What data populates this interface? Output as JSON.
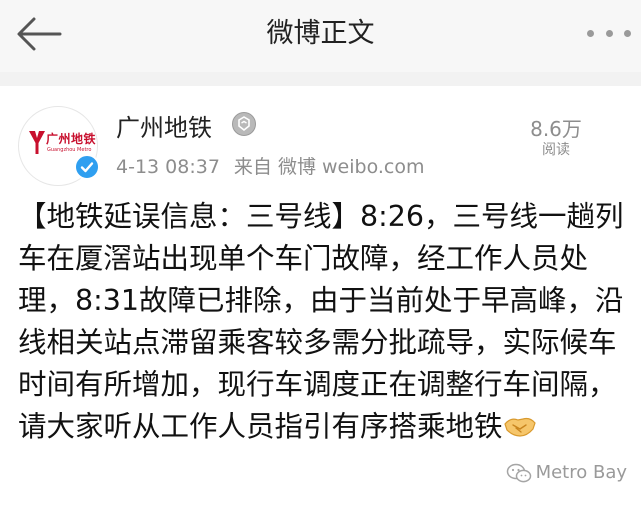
{
  "header": {
    "title": "微博正文",
    "back_icon": "back-arrow-icon",
    "more_icon": "more-dots-icon"
  },
  "post": {
    "avatar": {
      "logo_text_cn": "广州地铁",
      "logo_text_en": "Guangzhou Metro",
      "brand_color": "#c8102e"
    },
    "username": "广州地铁",
    "verified_color": "#2f9ff0",
    "timestamp": "4-13 08:37",
    "source": "来自 微博 weibo.com",
    "read_count": "8.6万",
    "read_label": "阅读",
    "content": "【地铁延误信息：三号线】8:26，三号线一趟列车在厦滘站出现单个车门故障，经工作人员处理，8:31故障已排除，由于当前处于早高峰，沿线相关站点滞留乘客较多需分批疏导，实际候车时间有所增加，现行车调度正在调整行车间隔，请大家听从工作人员指引有序搭乘地铁",
    "content_emoji": "handshake-emoji"
  },
  "watermark": {
    "text": "Metro Bay",
    "icon": "wechat-icon"
  }
}
